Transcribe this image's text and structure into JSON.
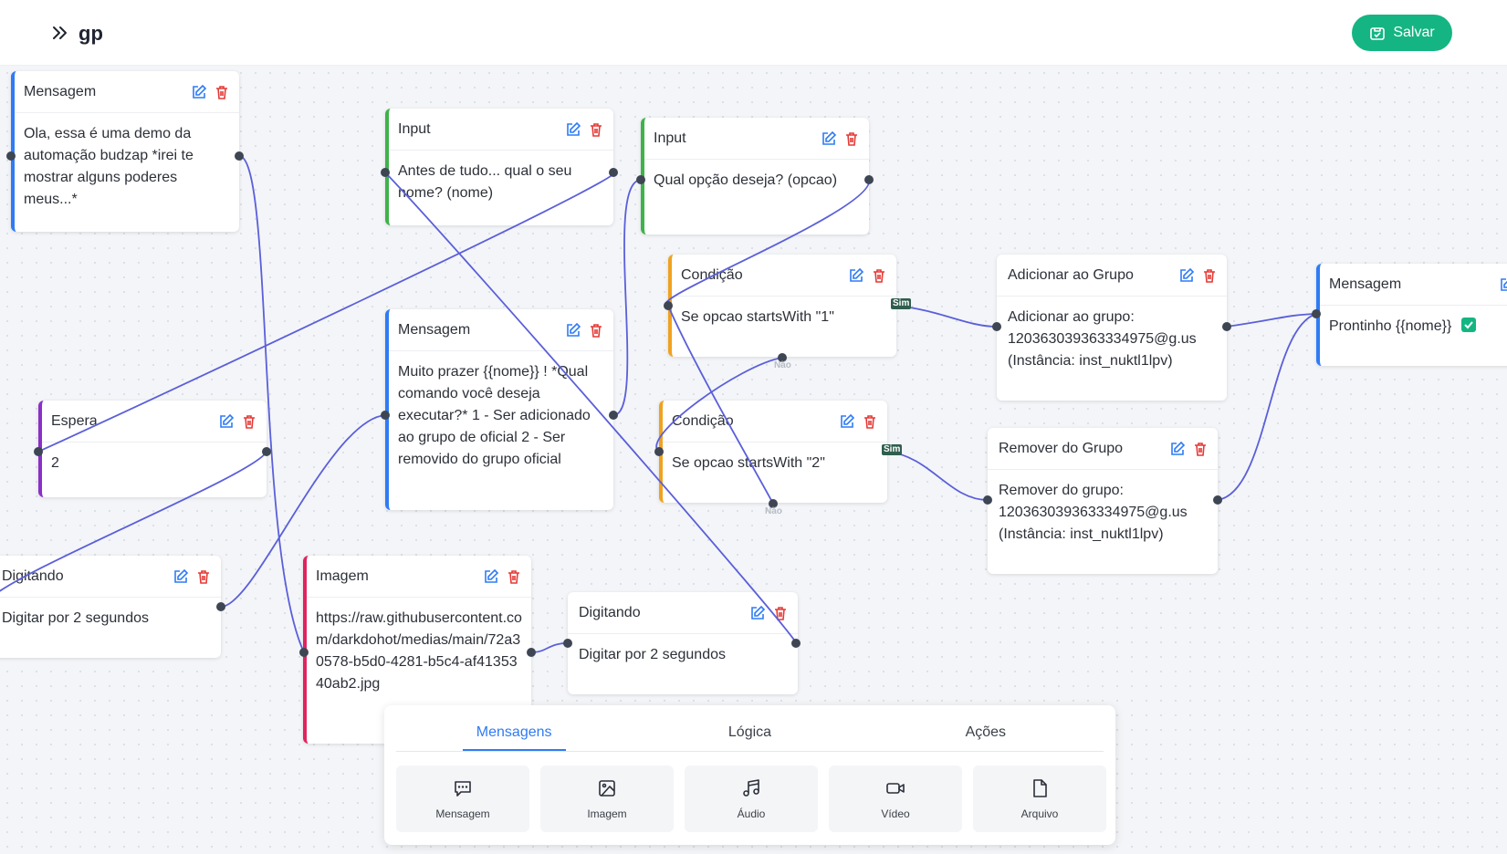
{
  "header": {
    "title": "gp",
    "save_label": "Salvar"
  },
  "colors": {
    "accent": "#14b582",
    "edge": "#5b5fd9",
    "mensagem": "#2f7bf5",
    "input": "#3fb24a",
    "espera": "#8b2fc9",
    "condicao": "#f0a21f",
    "imagem": "#e0245e"
  },
  "nodes": {
    "msg1": {
      "title": "Mensagem",
      "body": "Ola, essa é uma demo da automação budzap *irei te mostrar alguns poderes meus...*"
    },
    "input1": {
      "title": "Input",
      "body": "Antes de tudo... qual o seu nome? (nome)"
    },
    "input2": {
      "title": "Input",
      "body": "Qual opção deseja? (opcao)"
    },
    "cond1": {
      "title": "Condição",
      "body": "Se opcao startsWith \"1\""
    },
    "cond2": {
      "title": "Condição",
      "body": "Se opcao startsWith \"2\""
    },
    "addgroup": {
      "title": "Adicionar ao Grupo",
      "body": "Adicionar ao grupo: 120363039363334975@g.us (Instância: inst_nuktl1lpv)"
    },
    "removegroup": {
      "title": "Remover do Grupo",
      "body": "Remover do grupo: 120363039363334975@g.us (Instância: inst_nuktl1lpv)"
    },
    "msg3": {
      "title": "Mensagem",
      "body": "Prontinho {{nome}}"
    },
    "msg2": {
      "title": "Mensagem",
      "body": "Muito prazer {{nome}} ! *Qual comando você deseja executar?* 1 - Ser adicionado ao grupo de oficial 2 - Ser removido do grupo oficial"
    },
    "espera": {
      "title": "Espera",
      "body": "2"
    },
    "dig1": {
      "title": "Digitando",
      "body": "Digitar por 2 segundos"
    },
    "imagem": {
      "title": "Imagem",
      "body": "https://raw.githubusercontent.com/darkdohot/medias/main/72a30578-b5d0-4281-b5c4-af4135340ab2.jpg"
    },
    "dig2": {
      "title": "Digitando",
      "body": "Digitar por 2 segundos"
    }
  },
  "edge_labels": {
    "yes": "Sim",
    "no": "Não"
  },
  "palette": {
    "tabs": [
      "Mensagens",
      "Lógica",
      "Ações"
    ],
    "items": [
      {
        "label": "Mensagem",
        "icon": "message-icon"
      },
      {
        "label": "Imagem",
        "icon": "image-icon"
      },
      {
        "label": "Áudio",
        "icon": "music-icon"
      },
      {
        "label": "Vídeo",
        "icon": "video-icon"
      },
      {
        "label": "Arquivo",
        "icon": "file-icon"
      }
    ]
  }
}
